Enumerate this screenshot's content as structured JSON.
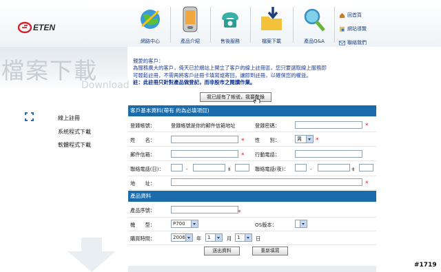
{
  "brand": {
    "logo_text": "ETEN"
  },
  "nav": {
    "items": [
      {
        "label": "網路中心"
      },
      {
        "label": "產品介紹"
      },
      {
        "label": "售後服務"
      },
      {
        "label": "檔案下載"
      },
      {
        "label": "產品Q&A"
      }
    ]
  },
  "quick_links": [
    {
      "label": "回首頁",
      "icon": "home-icon"
    },
    {
      "label": "網站導覽",
      "icon": "sitemap-icon"
    },
    {
      "label": "聯絡我們",
      "icon": "mail-icon"
    }
  ],
  "page_title": {
    "main": "檔案下載",
    "sub": "Download"
  },
  "sidebar": {
    "items": [
      {
        "label": "線上註冊"
      },
      {
        "label": "系統程式下載"
      },
      {
        "label": "軟體程式下載"
      }
    ]
  },
  "intro": {
    "greeting": "親愛的客戶：",
    "line1": "為服務廣大的客戶，倚天已於網站上開立了客戶的線上註冊區，您只要選取線上服務即",
    "line2": "可輕鬆註冊，不需再將客戶註冊卡填寫或寄回，讓即到註冊，以確保您的權益。",
    "note": "註：此註冊只針對產品做登記，而非股市之閱讀作業。"
  },
  "top_button": {
    "label": "我已經有了帳號，我要登錄"
  },
  "customer_section": {
    "title": "客戶基本資料(帶有  的為必填項目)",
    "account_label": "登錄帳號：",
    "account_hint": "登錄帳號是你的郵件信箱地址",
    "password_label": "登錄密碼：",
    "name_label": "姓　　名：",
    "gender_label": "性　　別：",
    "gender_value": "男",
    "email_label": "郵件信箱：",
    "mobile_label": "行動電話：",
    "phone_day_label": "聯絡電話(日)：",
    "phone_night_label": "聯絡電話(夜)：",
    "dash": "-",
    "ext": "‡",
    "address_label": "地　　址："
  },
  "product_section": {
    "title": "產品資料",
    "serial_label": "產品序號：",
    "model_label": "機　　型：",
    "model_value": "P700",
    "os_label": "OS版本：",
    "os_value": "",
    "purchase_label": "購買時間：",
    "year_value": "2006",
    "year_unit": "年",
    "month_value": "1",
    "month_unit": "月",
    "day_value": "1",
    "day_unit": "日"
  },
  "actions": {
    "submit_label": "送出資料",
    "reset_label": "重新填寫"
  },
  "page_number": "#1719",
  "colors": {
    "section_header": "#1b6aaa",
    "required": "#d6151b",
    "link_text": "#1d3f9a"
  }
}
